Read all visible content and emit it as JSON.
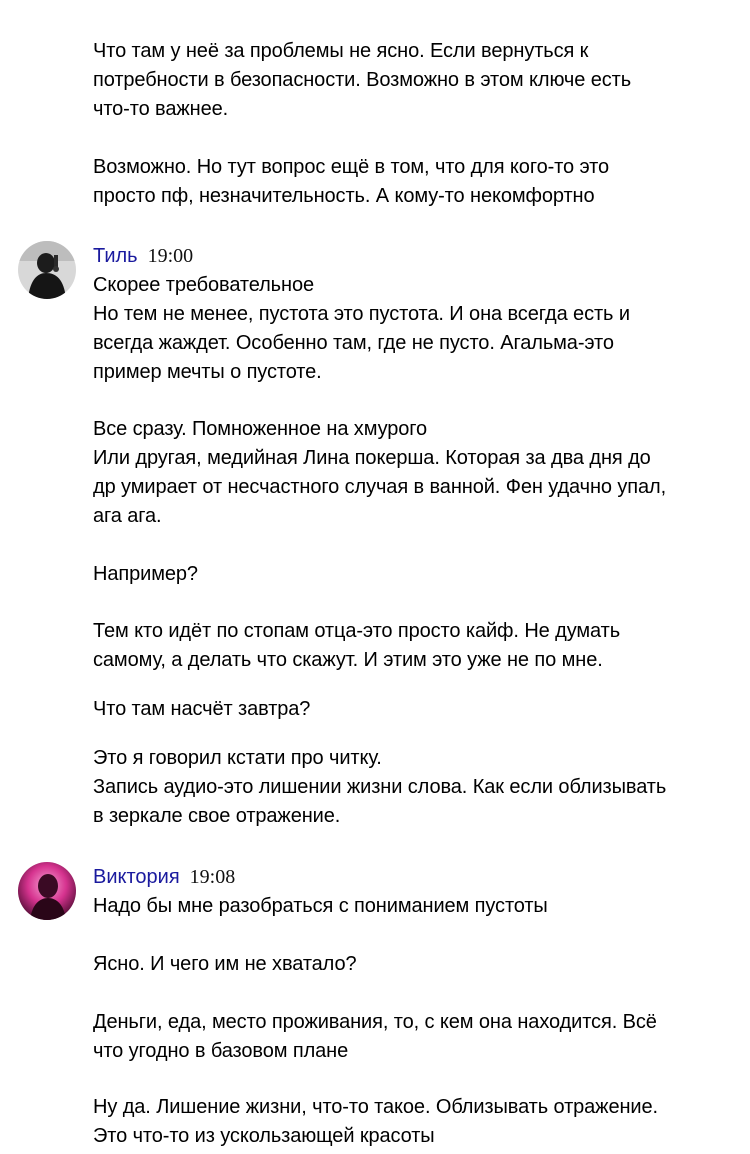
{
  "messages": [
    {
      "lines": [
        "Что там у неё за проблемы не ясно. Если вернуться к",
        "потребности в безопасности. Возможно в этом ключе есть",
        "что-то важнее."
      ]
    },
    {
      "lines": [
        "Возможно. Но тут вопрос ещё в том, что для кого-то это",
        "просто пф, незначительность. А кому-то некомфортно"
      ]
    },
    {
      "author": "Тиль",
      "time": "19:00",
      "avatar_icon": "user-avatar-dark",
      "lines": [
        "Скорее требовательное",
        "Но тем не менее, пустота это пустота. И она всегда есть и",
        "всегда жаждет. Особенно там, где не пусто. Агальма-это",
        "пример мечты о пустоте."
      ]
    },
    {
      "lines": [
        "Все сразу. Помноженное на хмурого",
        "Или другая, медийная Лина покерша. Которая за два дня до",
        "др умирает от несчастного случая в ванной. Фен удачно упал,",
        "ага ага."
      ]
    },
    {
      "lines": [
        "Например?"
      ]
    },
    {
      "lines": [
        "Тем кто идёт по стопам отца-это просто кайф. Не думать",
        "самому, а делать что скажут. И этим это уже не по мне."
      ]
    },
    {
      "lines": [
        "Что там насчёт завтра?"
      ]
    },
    {
      "lines": [
        "Это я говорил кстати про читку.",
        "Запись аудио-это лишении жизни слова. Как если облизывать",
        "в зеркале свое отражение."
      ]
    },
    {
      "author": "Виктория",
      "time": "19:08",
      "avatar_icon": "user-avatar-pink",
      "lines": [
        "Надо бы мне разобраться с пониманием пустоты"
      ]
    },
    {
      "lines": [
        "Ясно. И чего им не хватало?"
      ]
    },
    {
      "lines": [
        "Деньги, еда, место проживания, то, с кем она находится. Всё",
        "что угодно в базовом плане"
      ]
    },
    {
      "lines": [
        "Ну да. Лишение жизни, что-то такое. Облизывать отражение.",
        "Это что-то из ускользающей красоты"
      ]
    }
  ],
  "colors": {
    "author_name": "#1a1a9e",
    "text": "#000000",
    "background": "#ffffff"
  }
}
